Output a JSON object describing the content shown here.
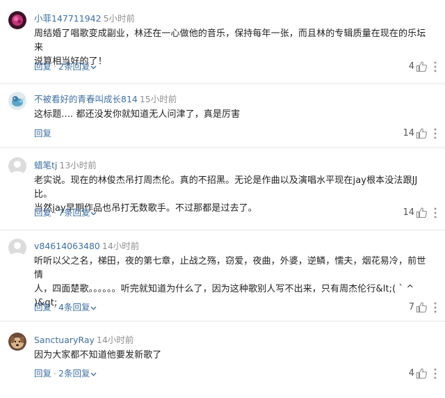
{
  "colors": {
    "username": "#3d6fa6",
    "timestamp": "#8f8f8f",
    "action": "#3d6fa6",
    "divider": "#e6e6e6"
  },
  "comments": [
    {
      "username": "小菲147711942",
      "time": "5小时前",
      "lines": [
        "周结婚了唱歌变成副业，林还在一心做他的音乐，保持每年一张，而且林的专辑质量在现在的乐坛来",
        "说算相当好的了！"
      ],
      "reply_label": "回复",
      "replies_label": "2条回复",
      "likes": "4",
      "avatar": "pink-flower-avatar"
    },
    {
      "username": "不被看好的青春叫成长814",
      "time": "15小时前",
      "lines": [
        "这标题.... 都还没发你就知道无人问津了，真是厉害"
      ],
      "reply_label": "回复",
      "replies_label": "",
      "likes": "14",
      "avatar": "bird-avatar"
    },
    {
      "username": "蜡笔tj",
      "time": "13小时前",
      "lines": [
        "老实说。现在的林俊杰吊打周杰伦。真的不招黑。无论是作曲以及演唱水平现在jay根本没法跟JJ比。",
        "当然jay早期作品也吊打无数歌手。不过那都是过去了。"
      ],
      "reply_label": "回复",
      "replies_label": "7条回复",
      "likes": "14",
      "avatar": "default-user-avatar"
    },
    {
      "username": "v84614063480",
      "time": "14小时前",
      "lines": [
        "听听以父之名，梯田，夜的第七章，止战之殇，窃爱，夜曲，外婆，逆鳞，懦夫，烟花易冷，前世情",
        "人，四面楚歌。。。。。。听完就知道为什么了，因为这种歌别人写不出来，只有周杰伦行&lt;( ` ^",
        " )&gt;"
      ],
      "reply_label": "回复",
      "replies_label": "4条回复",
      "likes": "7",
      "avatar": "default-user-avatar"
    },
    {
      "username": "SanctuaryRay",
      "time": "14小时前",
      "lines": [
        "因为大家都不知道他要发新歌了"
      ],
      "reply_label": "回复",
      "replies_label": "2条回复",
      "likes": "4",
      "avatar": "dog-avatar"
    }
  ]
}
